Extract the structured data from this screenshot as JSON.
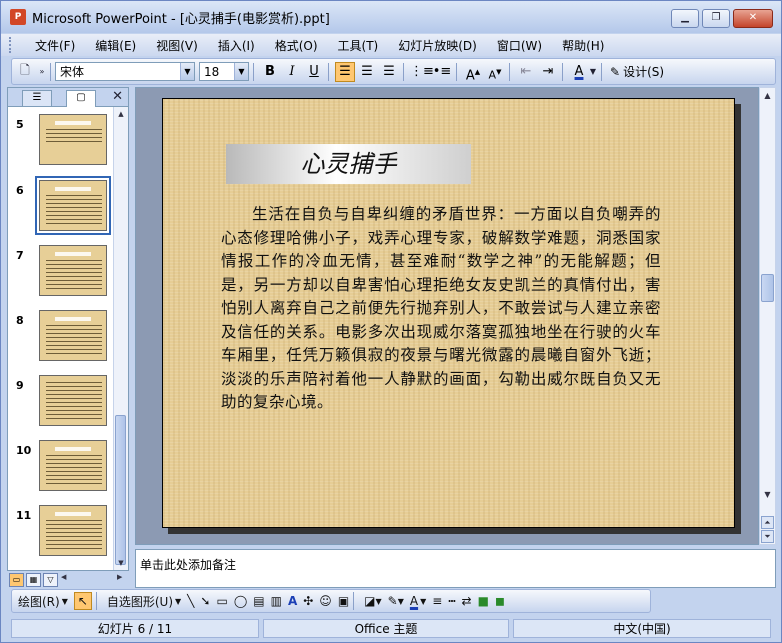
{
  "window": {
    "title": "Microsoft PowerPoint - [心灵捕手(电影赏析).ppt]",
    "app_icon": "powerpoint-icon",
    "controls": [
      "minimize-icon",
      "restore-icon",
      "close-icon"
    ]
  },
  "menu": {
    "items": [
      "文件(F)",
      "编辑(E)",
      "视图(V)",
      "插入(I)",
      "格式(O)",
      "工具(T)",
      "幻灯片放映(D)",
      "窗口(W)",
      "帮助(H)"
    ]
  },
  "toolbar": {
    "font_name": "宋体",
    "font_size": "18",
    "bold": "B",
    "italic": "I",
    "underline": "U",
    "design_label": "设计(S)"
  },
  "left_panel": {
    "tabs": [
      "outline-tab",
      "slides-tab"
    ],
    "thumbnails": [
      {
        "number": "5"
      },
      {
        "number": "6",
        "selected": true
      },
      {
        "number": "7"
      },
      {
        "number": "8"
      },
      {
        "number": "9"
      },
      {
        "number": "10"
      },
      {
        "number": "11"
      }
    ]
  },
  "slide": {
    "title": "心灵捕手",
    "body": "生活在自负与自卑纠缠的矛盾世界：一方面以自负嘲弄的心态修理哈佛小子，戏弄心理专家，破解数学难题，洞悉国家情报工作的冷血无情，甚至难耐“数学之神”的无能解题；但是，另一方却以自卑害怕心理拒绝女友史凯兰的真情付出，害怕别人离弃自己之前便先行抛弃别人，不敢尝试与人建立亲密及信任的关系。电影多次出现威尔落寞孤独地坐在行驶的火车车厢里，任凭万籁俱寂的夜景与曙光微露的晨曦自窗外飞逝；淡淡的乐声陪衬着他一人静默的画面，勾勒出威尔既自负又无助的复杂心境。"
  },
  "notes": {
    "placeholder": "单击此处添加备注"
  },
  "drawing_toolbar": {
    "draw_label": "绘图(R)",
    "autoshapes_label": "自选图形(U)"
  },
  "status": {
    "slide_info": "幻灯片 6 / 11",
    "theme": "Office 主题",
    "language": "中文(中国)"
  },
  "colors": {
    "slide_background": "#e6cd95",
    "selection_outline": "#3166b5",
    "active_button": "#ffc770"
  }
}
